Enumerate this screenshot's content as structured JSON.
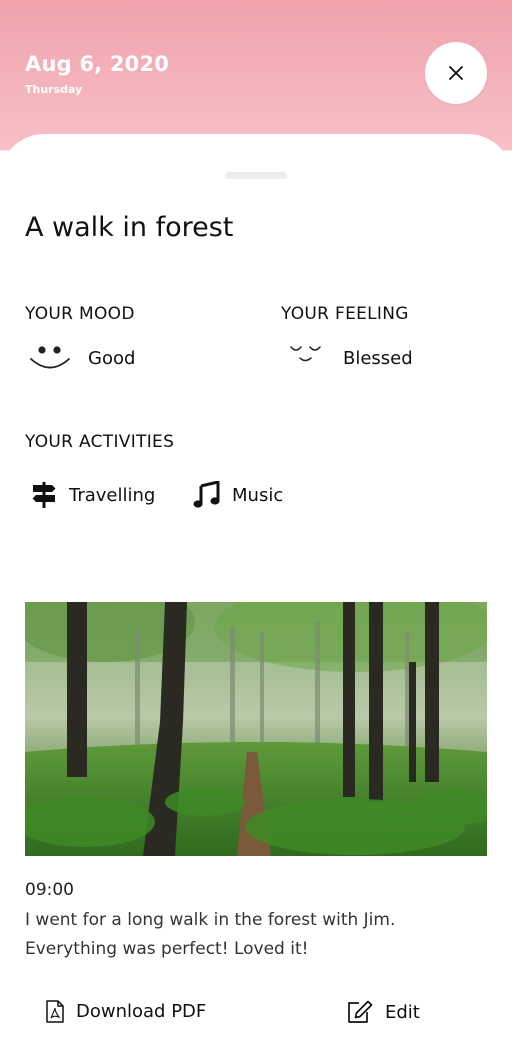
{
  "header": {
    "date": "Aug 6, 2020",
    "weekday": "Thursday",
    "close_icon": "close-icon"
  },
  "entry": {
    "title": "A walk in forest",
    "mood": {
      "label": "YOUR MOOD",
      "value": "Good",
      "icon": "smiley-face-icon"
    },
    "feeling": {
      "label": "YOUR FEELING",
      "value": "Blessed",
      "icon": "blessed-face-icon"
    },
    "activities": {
      "label": "YOUR ACTIVITIES",
      "items": [
        {
          "label": "Travelling",
          "icon": "signpost-icon"
        },
        {
          "label": "Music",
          "icon": "music-note-icon"
        }
      ]
    },
    "photo_icon": "forest-photo",
    "time": "09:00",
    "note": "I went for a long walk in the forest with Jim. Everything was perfect! Loved it!"
  },
  "actions": {
    "download_label": "Download PDF",
    "edit_label": "Edit"
  },
  "colors": {
    "header_top": "#f0a2ad",
    "header_bottom": "#f7c0c6",
    "text": "#111111"
  }
}
